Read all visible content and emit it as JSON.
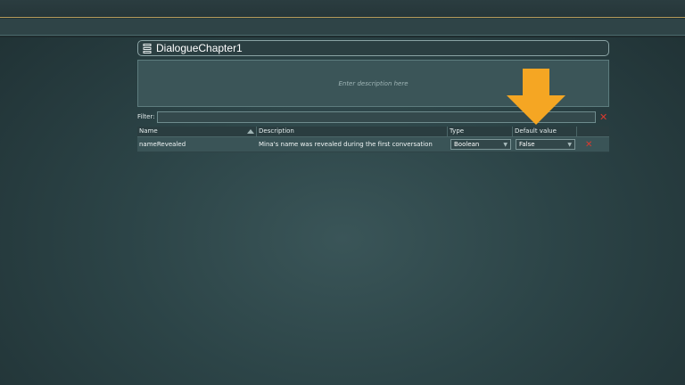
{
  "editor": {
    "title": "DialogueChapter1",
    "title_icon": "database-icon",
    "description_placeholder": "Enter description here",
    "filter_label": "Filter:",
    "filter_value": "",
    "filter_clear_glyph": "✕"
  },
  "table": {
    "columns": [
      "Name",
      "Description",
      "Type",
      "Default value"
    ],
    "rows": [
      {
        "name": "nameRevealed",
        "description": "Mina's name was revealed during the first conversation",
        "type": "Boolean",
        "default_value": "False",
        "delete_glyph": "✕"
      }
    ]
  },
  "colors": {
    "accent_arrow": "#f5a623",
    "delete_red": "#d93a2f",
    "panel_border": "#8aa3a4"
  }
}
